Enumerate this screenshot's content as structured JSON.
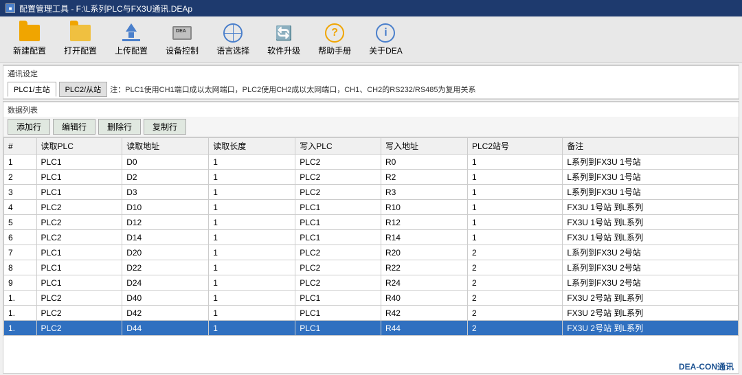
{
  "titleBar": {
    "title": "配置管理工具 - F:\\L系列PLC与FX3U通讯.DEAp"
  },
  "toolbar": {
    "buttons": [
      {
        "id": "new-config",
        "label": "新建配置",
        "icon": "folder-new"
      },
      {
        "id": "open-config",
        "label": "打开配置",
        "icon": "folder-open"
      },
      {
        "id": "upload-config",
        "label": "上传配置",
        "icon": "upload"
      },
      {
        "id": "device-control",
        "label": "设备控制",
        "icon": "device"
      },
      {
        "id": "lang-select",
        "label": "语言选择",
        "icon": "lang"
      },
      {
        "id": "software-upgrade",
        "label": "软件升级",
        "icon": "upgrade"
      },
      {
        "id": "help-manual",
        "label": "帮助手册",
        "icon": "help"
      },
      {
        "id": "about-dea",
        "label": "关于DEA",
        "icon": "about"
      }
    ]
  },
  "commSection": {
    "label": "通讯设定",
    "tabs": [
      {
        "id": "plc1-master",
        "label": "PLC1/主站",
        "active": true
      },
      {
        "id": "plc2-slave",
        "label": "PLC2/从站",
        "active": false
      }
    ],
    "note": "注：PLC1使用CH1端口成以太网端口，PLC2使用CH2成以太网端口，CH1、CH2的RS232/RS485为复用关系"
  },
  "dataSection": {
    "label": "数据列表",
    "buttons": [
      {
        "id": "add-row",
        "label": "添加行"
      },
      {
        "id": "edit-row",
        "label": "编辑行"
      },
      {
        "id": "delete-row",
        "label": "删除行"
      },
      {
        "id": "copy-row",
        "label": "复制行"
      }
    ],
    "columns": [
      "#",
      "读取PLC",
      "读取地址",
      "读取长度",
      "写入PLC",
      "写入地址",
      "PLC2站号",
      "备注"
    ],
    "rows": [
      {
        "num": "1",
        "readPlc": "PLC1",
        "readAddr": "D0",
        "readLen": "1",
        "writePlc": "PLC2",
        "writeAddr": "R0",
        "plc2No": "1",
        "note": "L系列到FX3U  1号站",
        "selected": false
      },
      {
        "num": "2",
        "readPlc": "PLC1",
        "readAddr": "D2",
        "readLen": "1",
        "writePlc": "PLC2",
        "writeAddr": "R2",
        "plc2No": "1",
        "note": "L系列到FX3U  1号站",
        "selected": false
      },
      {
        "num": "3",
        "readPlc": "PLC1",
        "readAddr": "D3",
        "readLen": "1",
        "writePlc": "PLC2",
        "writeAddr": "R3",
        "plc2No": "1",
        "note": "L系列到FX3U  1号站",
        "selected": false
      },
      {
        "num": "4",
        "readPlc": "PLC2",
        "readAddr": "D10",
        "readLen": "1",
        "writePlc": "PLC1",
        "writeAddr": "R10",
        "plc2No": "1",
        "note": "FX3U  1号站 到L系列",
        "selected": false
      },
      {
        "num": "5",
        "readPlc": "PLC2",
        "readAddr": "D12",
        "readLen": "1",
        "writePlc": "PLC1",
        "writeAddr": "R12",
        "plc2No": "1",
        "note": "FX3U  1号站 到L系列",
        "selected": false
      },
      {
        "num": "6",
        "readPlc": "PLC2",
        "readAddr": "D14",
        "readLen": "1",
        "writePlc": "PLC1",
        "writeAddr": "R14",
        "plc2No": "1",
        "note": "FX3U  1号站 到L系列",
        "selected": false
      },
      {
        "num": "7",
        "readPlc": "PLC1",
        "readAddr": "D20",
        "readLen": "1",
        "writePlc": "PLC2",
        "writeAddr": "R20",
        "plc2No": "2",
        "note": "L系列到FX3U  2号站",
        "selected": false
      },
      {
        "num": "8",
        "readPlc": "PLC1",
        "readAddr": "D22",
        "readLen": "1",
        "writePlc": "PLC2",
        "writeAddr": "R22",
        "plc2No": "2",
        "note": "L系列到FX3U  2号站",
        "selected": false
      },
      {
        "num": "9",
        "readPlc": "PLC1",
        "readAddr": "D24",
        "readLen": "1",
        "writePlc": "PLC2",
        "writeAddr": "R24",
        "plc2No": "2",
        "note": "L系列到FX3U  2号站",
        "selected": false
      },
      {
        "num": "1.",
        "readPlc": "PLC2",
        "readAddr": "D40",
        "readLen": "1",
        "writePlc": "PLC1",
        "writeAddr": "R40",
        "plc2No": "2",
        "note": "FX3U  2号站 到L系列",
        "selected": false
      },
      {
        "num": "1.",
        "readPlc": "PLC2",
        "readAddr": "D42",
        "readLen": "1",
        "writePlc": "PLC1",
        "writeAddr": "R42",
        "plc2No": "2",
        "note": "FX3U  2号站 到L系列",
        "selected": false
      },
      {
        "num": "1.",
        "readPlc": "PLC2",
        "readAddr": "D44",
        "readLen": "1",
        "writePlc": "PLC1",
        "writeAddr": "R44",
        "plc2No": "2",
        "note": "FX3U  2号站 到L系列",
        "selected": true
      }
    ]
  },
  "footer": {
    "text": "DEA-CON通讯"
  }
}
